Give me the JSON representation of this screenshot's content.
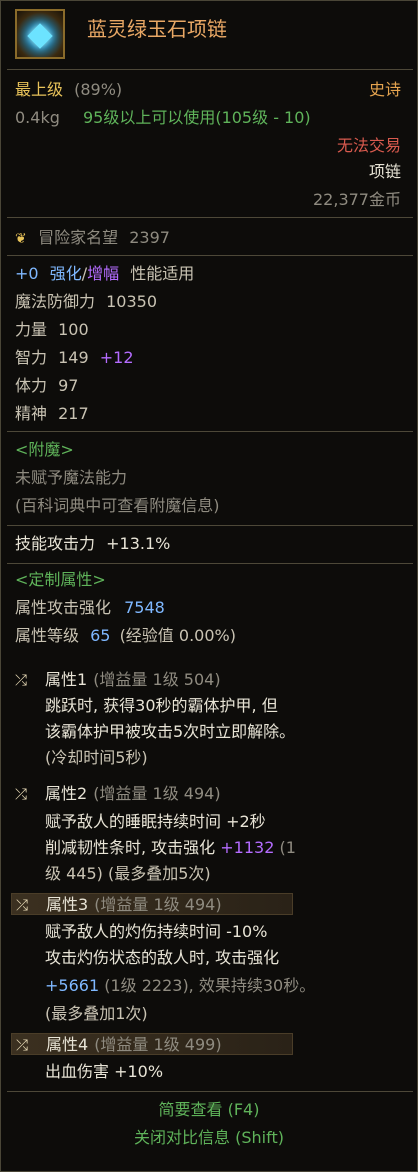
{
  "item": {
    "name": "蓝灵绿玉石项链",
    "icon": "blue-jade-necklace-icon",
    "grade": "最上级",
    "grade_pct": "(89%)",
    "rarity": "史诗",
    "weight": "0.4kg",
    "level_req": "95级以上可以使用(105级 - 10)",
    "trade": "无法交易",
    "type": "项链",
    "price": "22,377金币"
  },
  "fame": {
    "label": "冒险家名望",
    "value": "2397"
  },
  "reinforce": {
    "plus": "+0",
    "enhance": "强化",
    "sep": "/",
    "amplify": "增幅",
    "suffix": "性能适用"
  },
  "stats": {
    "magic_def_label": "魔法防御力",
    "magic_def": "10350",
    "str_label": "力量",
    "str": "100",
    "int_label": "智力",
    "int": "149",
    "int_bonus": "+12",
    "vit_label": "体力",
    "vit": "97",
    "spi_label": "精神",
    "spi": "217"
  },
  "enchant": {
    "header": "<附魔>",
    "line1": "未赋予魔法能力",
    "line2": "(百科词典中可查看附魔信息)"
  },
  "skill_atk": {
    "label": "技能攻击力",
    "value": "+13.1%"
  },
  "custom": {
    "header": "<定制属性>",
    "elem_label": "属性攻击强化",
    "elem_value": "7548",
    "lvl_label": "属性等级",
    "lvl_value": "65",
    "lvl_exp": "(经验值 0.00%)"
  },
  "attrs": [
    {
      "name": "属性1",
      "gain": "(增益量 1级 504)",
      "lines": [
        "跳跃时, 获得30秒的霸体护甲, 但",
        "该霸体护甲被攻击5次时立即解除。"
      ],
      "note": "(冷却时间5秒)"
    },
    {
      "name": "属性2",
      "gain": "(增益量 1级 494)",
      "line1": "赋予敌人的睡眠持续时间 +2秒",
      "line2a": "削减韧性条时, 攻击强化 ",
      "line2b": "+1132",
      "line2c": " (1",
      "line3": "级 445) (最多叠加5次)"
    },
    {
      "name": "属性3",
      "gain": "(增益量 1级 494)",
      "line1": "赋予敌人的灼伤持续时间 -10%",
      "line2": "攻击灼伤状态的敌人时, 攻击强化",
      "line3a": "+5661",
      "line3b": " (1级 2223), 效果持续30秒。",
      "note": "(最多叠加1次)"
    },
    {
      "name": "属性4",
      "gain": "(增益量 1级 499)",
      "line1": "出血伤害 +10%"
    }
  ],
  "footer": {
    "summary": "简要查看 (F4)",
    "close_compare": "关闭对比信息 (Shift)"
  },
  "colors": {
    "item_name": "#e9a865",
    "grade": "#e8c35a",
    "epic": "#e5a44f",
    "green": "#5fb35a",
    "untradeable": "#d85a4e",
    "blue_stat": "#73b7ff",
    "purple_stat": "#b46cff"
  }
}
